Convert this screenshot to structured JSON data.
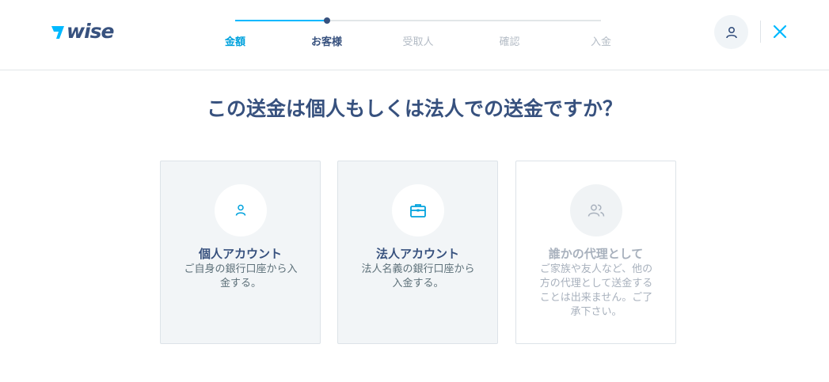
{
  "header": {
    "logo_text": "wise",
    "steps": [
      {
        "label": "金額",
        "state": "done"
      },
      {
        "label": "お客様",
        "state": "current"
      },
      {
        "label": "受取人",
        "state": "upcoming"
      },
      {
        "label": "確認",
        "state": "upcoming"
      },
      {
        "label": "入金",
        "state": "upcoming"
      }
    ],
    "progress_fraction": 0.25,
    "account_icon": "user-icon",
    "close_icon": "close-icon"
  },
  "main": {
    "question": "この送金は個人もしくは法人での送金ですか？",
    "options": [
      {
        "title": "個人アカウント",
        "description": "ご自身の銀行口座から入金する。",
        "icon": "person-icon",
        "enabled": true
      },
      {
        "title": "法人アカウント",
        "description": "法人名義の銀行口座から入金する。",
        "icon": "briefcase-icon",
        "enabled": true
      },
      {
        "title": "誰かの代理として",
        "description": "ご家族や友人など、他の方の代理として送金することは出来ません。ご了承下さい。",
        "icon": "people-icon",
        "enabled": false
      }
    ]
  },
  "colors": {
    "brand_navy": "#37517e",
    "accent_blue": "#00b9ff",
    "muted": "#a8b1bd"
  }
}
